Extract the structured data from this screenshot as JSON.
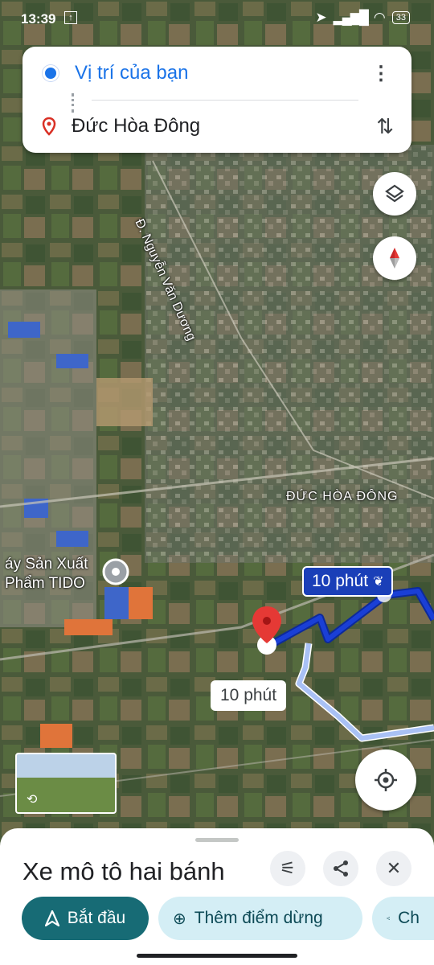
{
  "status_bar": {
    "time": "13:39",
    "battery": "33"
  },
  "route": {
    "origin": "Vị trí của bạn",
    "destination": "Đức Hòa Đông"
  },
  "map": {
    "road_label": "Đ. Nguyễn Văn Dương",
    "area_label": "ĐỨC HÒA ĐÔNG",
    "poi_line1": "áy Sản Xuất",
    "poi_line2": "Phẩm TIDO",
    "primary_route_time": "10 phút",
    "alt_route_time": "10 phút",
    "colors": {
      "primary_route": "#1a3fd6",
      "alt_route": "#a9c1f5",
      "destination_pin": "#e53935"
    }
  },
  "bottom_sheet": {
    "travel_mode": "Xe mô tô hai bánh",
    "start_label": "Bắt đầu",
    "add_stop_label": "Thêm điểm dừng",
    "share_label": "Ch"
  },
  "icons": [
    "location-arrow-icon",
    "signal-icon",
    "wifi-icon",
    "layers-icon",
    "compass-icon",
    "recenter-icon",
    "options-icon",
    "share-icon",
    "close-icon",
    "navigate-icon",
    "add-stop-icon",
    "eco-leaf-icon"
  ]
}
